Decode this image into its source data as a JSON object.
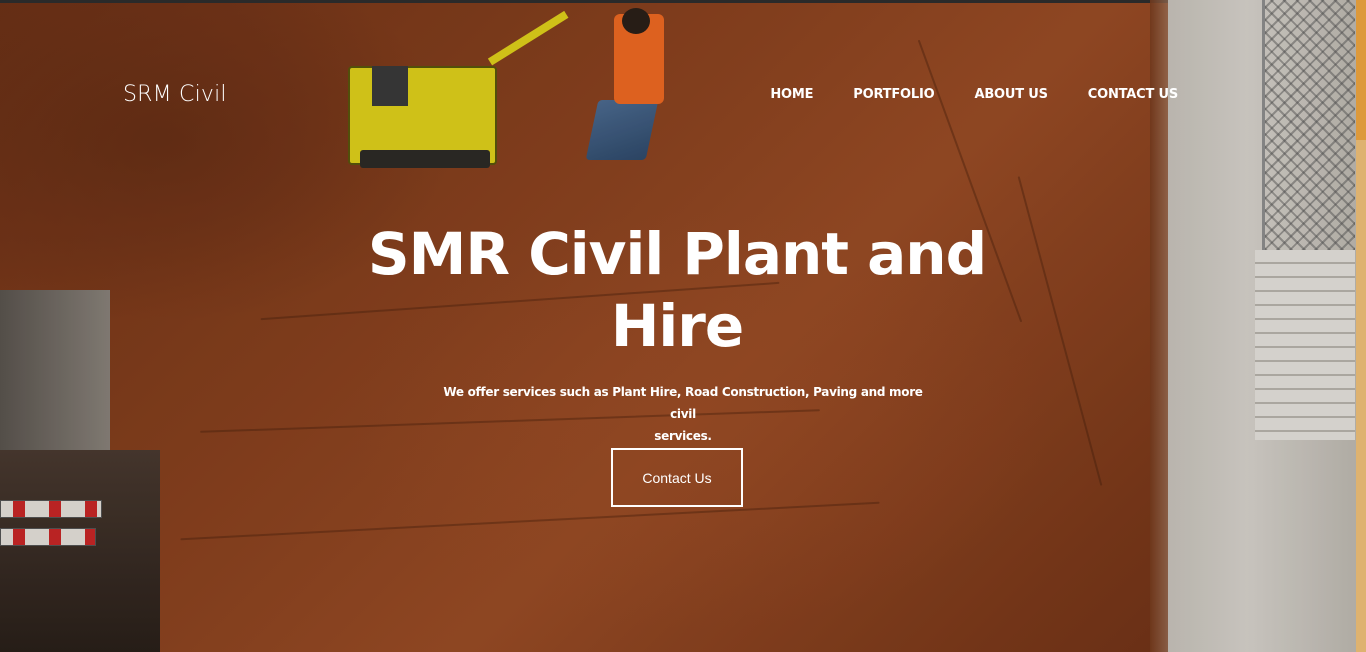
{
  "header": {
    "brand": "SRM Civil",
    "nav": [
      {
        "label": "HOME"
      },
      {
        "label": "PORTFOLIO"
      },
      {
        "label": "ABOUT US"
      },
      {
        "label": "CONTACT US"
      }
    ]
  },
  "hero": {
    "title_line1": "SMR Civil Plant and",
    "title_line2": "Hire",
    "subtitle_line1": "We offer services such as Plant Hire, Road Construction, Paving and more civil",
    "subtitle_line2": "services.",
    "cta_label": "Contact Us",
    "background_image": "construction-site-compactor-photo"
  },
  "colors": {
    "soil": "#8a421f",
    "text": "#ffffff",
    "accent": "#f0a640"
  }
}
